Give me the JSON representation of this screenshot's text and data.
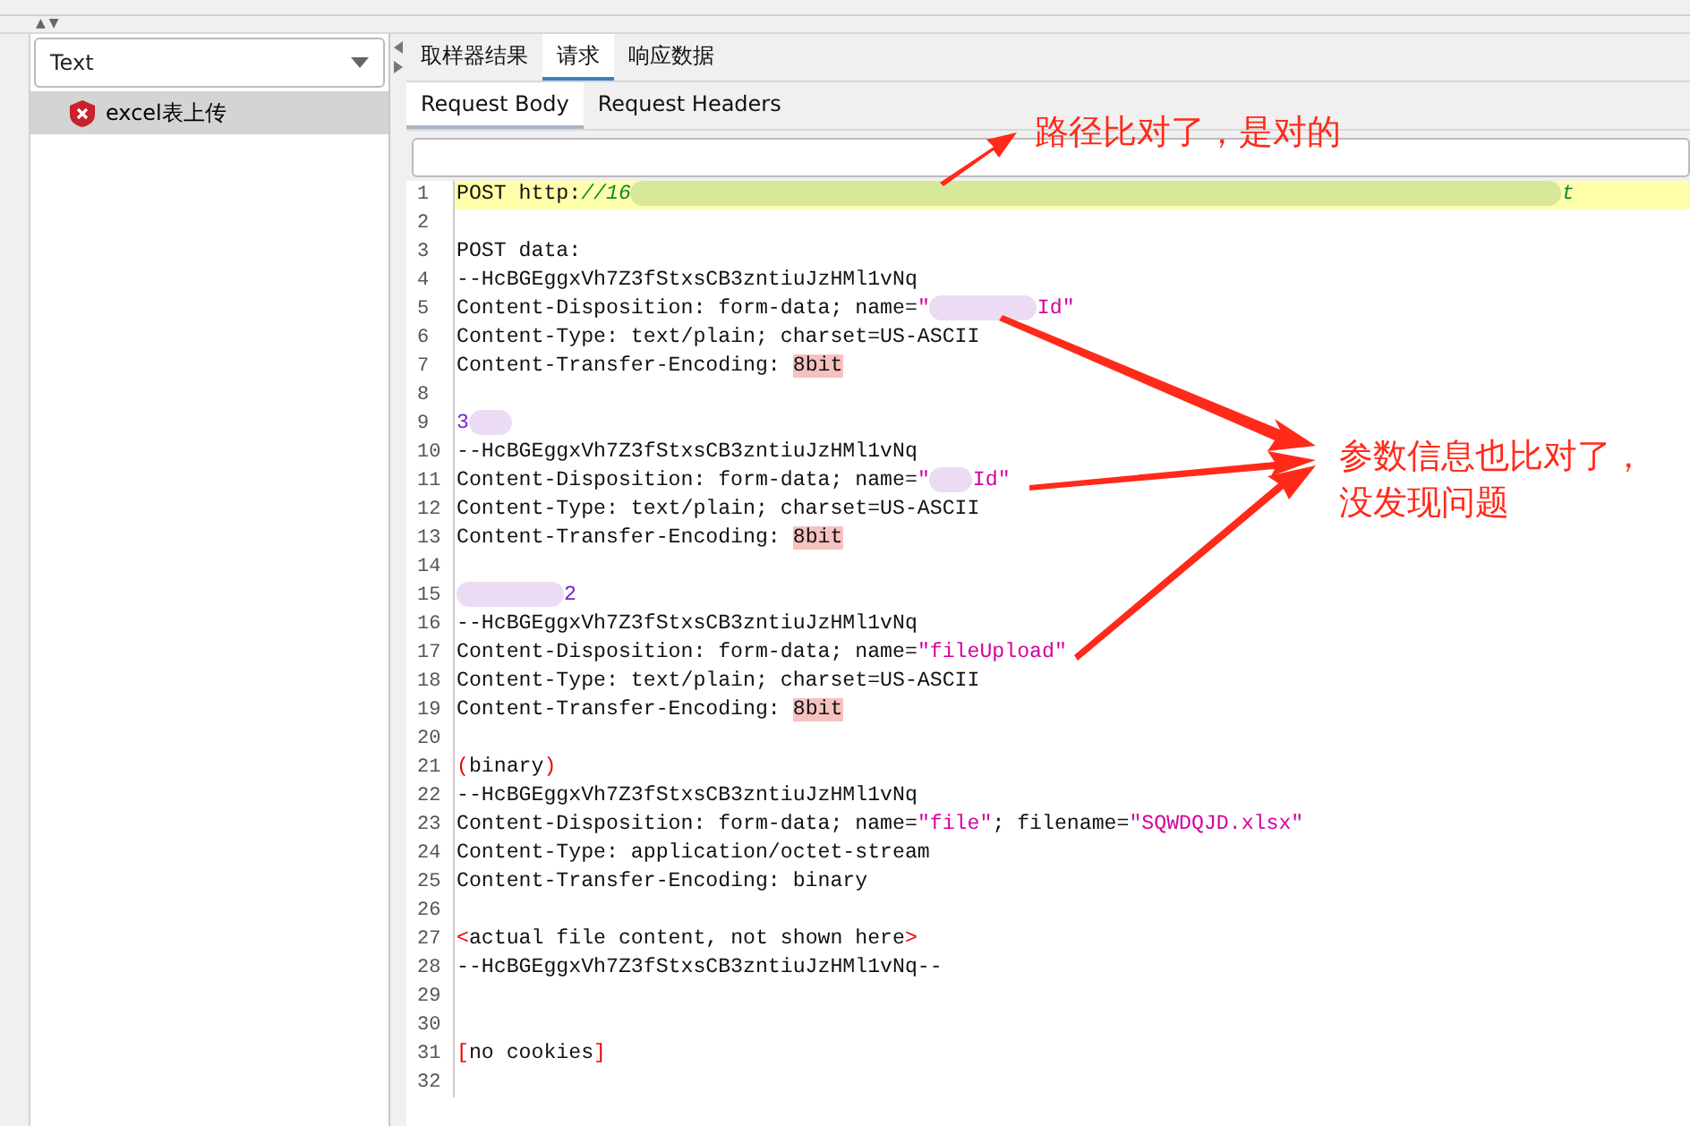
{
  "top_bar": {
    "arrows": [
      "▲",
      "▼"
    ]
  },
  "left_panel": {
    "view_select": {
      "value": "Text"
    },
    "tree": [
      {
        "label": "excel表上传",
        "selected": true
      }
    ]
  },
  "tabs": [
    {
      "label": "取样器结果",
      "selected": false
    },
    {
      "label": "请求",
      "selected": true
    },
    {
      "label": "响应数据",
      "selected": false
    }
  ],
  "sub_tabs": [
    {
      "label": "Request Body",
      "selected": true
    },
    {
      "label": "Request Headers",
      "selected": false
    }
  ],
  "code_lines": [
    {
      "number": "1",
      "highlighted": true,
      "segments": [
        {
          "kind": "plain",
          "text": "POST http:"
        },
        {
          "kind": "url",
          "text": "//16"
        },
        {
          "kind": "redacted_wide"
        },
        {
          "kind": "url",
          "text": "t"
        }
      ]
    },
    {
      "number": "2",
      "highlighted": false
    },
    {
      "number": "3",
      "highlighted": false,
      "segments": [
        {
          "kind": "plain",
          "text": "POST data:"
        }
      ]
    },
    {
      "number": "4",
      "highlighted": false,
      "segments": [
        {
          "kind": "plain",
          "text": "--HcBGEggxVh7Z3fStxsCB3zntiuJzHMl1vNq"
        }
      ]
    },
    {
      "number": "5",
      "highlighted": false,
      "segments": [
        {
          "kind": "plain",
          "text": "Content-Disposition: form-data; name="
        },
        {
          "kind": "string",
          "text": "\""
        },
        {
          "kind": "redacted"
        },
        {
          "kind": "string",
          "text": "Id\""
        }
      ]
    },
    {
      "number": "6",
      "highlighted": false,
      "segments": [
        {
          "kind": "plain",
          "text": "Content-Type: text/plain; charset=US-ASCII"
        }
      ]
    },
    {
      "number": "7",
      "highlighted": false,
      "segments": [
        {
          "kind": "plain",
          "text": "Content-Transfer-Encoding: "
        },
        {
          "kind": "mark",
          "text": "8bit"
        }
      ]
    },
    {
      "number": "8",
      "highlighted": false
    },
    {
      "number": "9",
      "highlighted": false,
      "segments": [
        {
          "kind": "number",
          "text": "3"
        },
        {
          "kind": "redacted_small"
        }
      ]
    },
    {
      "number": "10",
      "highlighted": false,
      "segments": [
        {
          "kind": "plain",
          "text": "--HcBGEggxVh7Z3fStxsCB3zntiuJzHMl1vNq"
        }
      ]
    },
    {
      "number": "11",
      "highlighted": false,
      "segments": [
        {
          "kind": "plain",
          "text": "Content-Disposition: form-data; name="
        },
        {
          "kind": "string",
          "text": "\""
        },
        {
          "kind": "redacted_small"
        },
        {
          "kind": "string",
          "text": "Id\""
        }
      ]
    },
    {
      "number": "12",
      "highlighted": false,
      "segments": [
        {
          "kind": "plain",
          "text": "Content-Type: text/plain; charset=US-ASCII"
        }
      ]
    },
    {
      "number": "13",
      "highlighted": false,
      "segments": [
        {
          "kind": "plain",
          "text": "Content-Transfer-Encoding: "
        },
        {
          "kind": "mark",
          "text": "8bit"
        }
      ]
    },
    {
      "number": "14",
      "highlighted": false
    },
    {
      "number": "15",
      "highlighted": false,
      "segments": [
        {
          "kind": "redacted"
        },
        {
          "kind": "number",
          "text": "2"
        }
      ]
    },
    {
      "number": "16",
      "highlighted": false,
      "segments": [
        {
          "kind": "plain",
          "text": "--HcBGEggxVh7Z3fStxsCB3zntiuJzHMl1vNq"
        }
      ]
    },
    {
      "number": "17",
      "highlighted": false,
      "segments": [
        {
          "kind": "plain",
          "text": "Content-Disposition: form-data; name="
        },
        {
          "kind": "string",
          "text": "\"fileUpload\""
        }
      ]
    },
    {
      "number": "18",
      "highlighted": false,
      "segments": [
        {
          "kind": "plain",
          "text": "Content-Type: text/plain; charset=US-ASCII"
        }
      ]
    },
    {
      "number": "19",
      "highlighted": false,
      "segments": [
        {
          "kind": "plain",
          "text": "Content-Transfer-Encoding: "
        },
        {
          "kind": "mark",
          "text": "8bit"
        }
      ]
    },
    {
      "number": "20",
      "highlighted": false
    },
    {
      "number": "21",
      "highlighted": false,
      "segments": [
        {
          "kind": "bracket",
          "text": "("
        },
        {
          "kind": "plain",
          "text": "binary"
        },
        {
          "kind": "bracket",
          "text": ")"
        }
      ]
    },
    {
      "number": "22",
      "highlighted": false,
      "segments": [
        {
          "kind": "plain",
          "text": "--HcBGEggxVh7Z3fStxsCB3zntiuJzHMl1vNq"
        }
      ]
    },
    {
      "number": "23",
      "highlighted": false,
      "segments": [
        {
          "kind": "plain",
          "text": "Content-Disposition: form-data; name="
        },
        {
          "kind": "string",
          "text": "\"file\""
        },
        {
          "kind": "plain",
          "text": "; filename="
        },
        {
          "kind": "string",
          "text": "\"SQWDQJD.xlsx\""
        }
      ]
    },
    {
      "number": "24",
      "highlighted": false,
      "segments": [
        {
          "kind": "plain",
          "text": "Content-Type: application/octet-stream"
        }
      ]
    },
    {
      "number": "25",
      "highlighted": false,
      "segments": [
        {
          "kind": "plain",
          "text": "Content-Transfer-Encoding: binary"
        }
      ]
    },
    {
      "number": "26",
      "highlighted": false
    },
    {
      "number": "27",
      "highlighted": false,
      "segments": [
        {
          "kind": "bracket",
          "text": "<"
        },
        {
          "kind": "plain",
          "text": "actual file content, not shown here"
        },
        {
          "kind": "bracket",
          "text": ">"
        }
      ]
    },
    {
      "number": "28",
      "highlighted": false,
      "segments": [
        {
          "kind": "plain",
          "text": "--HcBGEggxVh7Z3fStxsCB3zntiuJzHMl1vNq--"
        }
      ]
    },
    {
      "number": "29",
      "highlighted": false
    },
    {
      "number": "30",
      "highlighted": false
    },
    {
      "number": "31",
      "highlighted": false,
      "segments": [
        {
          "kind": "bracket",
          "text": "["
        },
        {
          "kind": "plain",
          "text": "no cookies"
        },
        {
          "kind": "bracket",
          "text": "]"
        }
      ]
    },
    {
      "number": "32",
      "highlighted": false
    }
  ],
  "annotations": [
    {
      "kind": "path_note",
      "lines": [
        "路径比对了，是对的"
      ]
    },
    {
      "kind": "param_note",
      "lines": [
        "参数信息也比对了，",
        "没发现问题"
      ]
    }
  ]
}
